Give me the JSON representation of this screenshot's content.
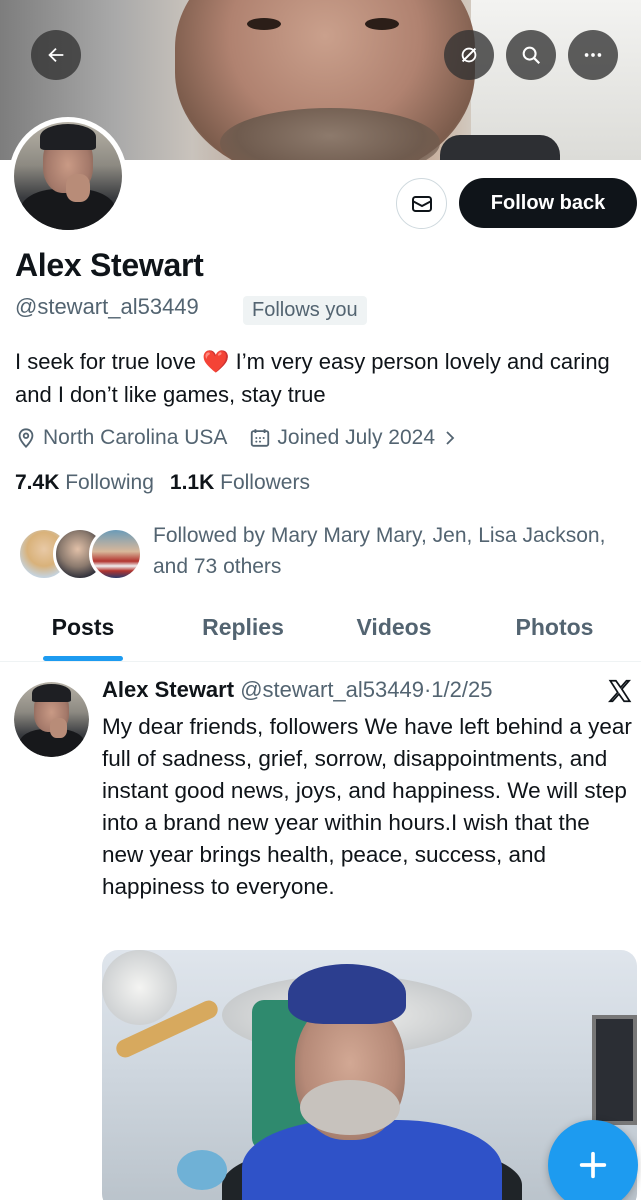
{
  "header": {
    "back_icon": "arrow-left-icon",
    "grok_icon": "grok-icon",
    "search_icon": "search-icon",
    "more_icon": "more-horizontal-icon"
  },
  "profile": {
    "name": "Alex Stewart",
    "handle": "@stewart_al53449",
    "follows_you": "Follows you",
    "follow_button": "Follow back",
    "message_icon": "mail-icon",
    "bio_part1": "I seek for true love ",
    "bio_heart": "❤️",
    "bio_part2": " I’m very easy person lovely and caring and I don’t like games, stay true",
    "location": "North Carolina USA",
    "joined": "Joined July 2024",
    "following_count": "7.4K",
    "following_label": "Following",
    "followers_count": "1.1K",
    "followers_label": "Followers",
    "followed_by": "Followed by Mary Mary Mary, Jen, Lisa Jackson, and 73 others"
  },
  "tabs": [
    {
      "label": "Posts",
      "active": true
    },
    {
      "label": "Replies",
      "active": false
    },
    {
      "label": "Videos",
      "active": false
    },
    {
      "label": "Photos",
      "active": false
    }
  ],
  "post": {
    "name": "Alex Stewart",
    "handle": "@stewart_al53449",
    "separator": "·",
    "date": "1/2/25",
    "source_icon": "x-logo-icon",
    "text": "My dear friends, followers We have left behind a year full of sadness, grief, sorrow, disappointments, and instant good news, joys, and happiness. We will step into a brand new year within hours.I wish that the new year brings health, peace, success, and happiness to everyone."
  },
  "fab": {
    "icon": "plus-icon"
  },
  "colors": {
    "accent": "#1d9bf0",
    "text_primary": "#0f1419",
    "text_secondary": "#536471",
    "follow_button_bg": "#0f1419",
    "heart": "#e0245e"
  }
}
